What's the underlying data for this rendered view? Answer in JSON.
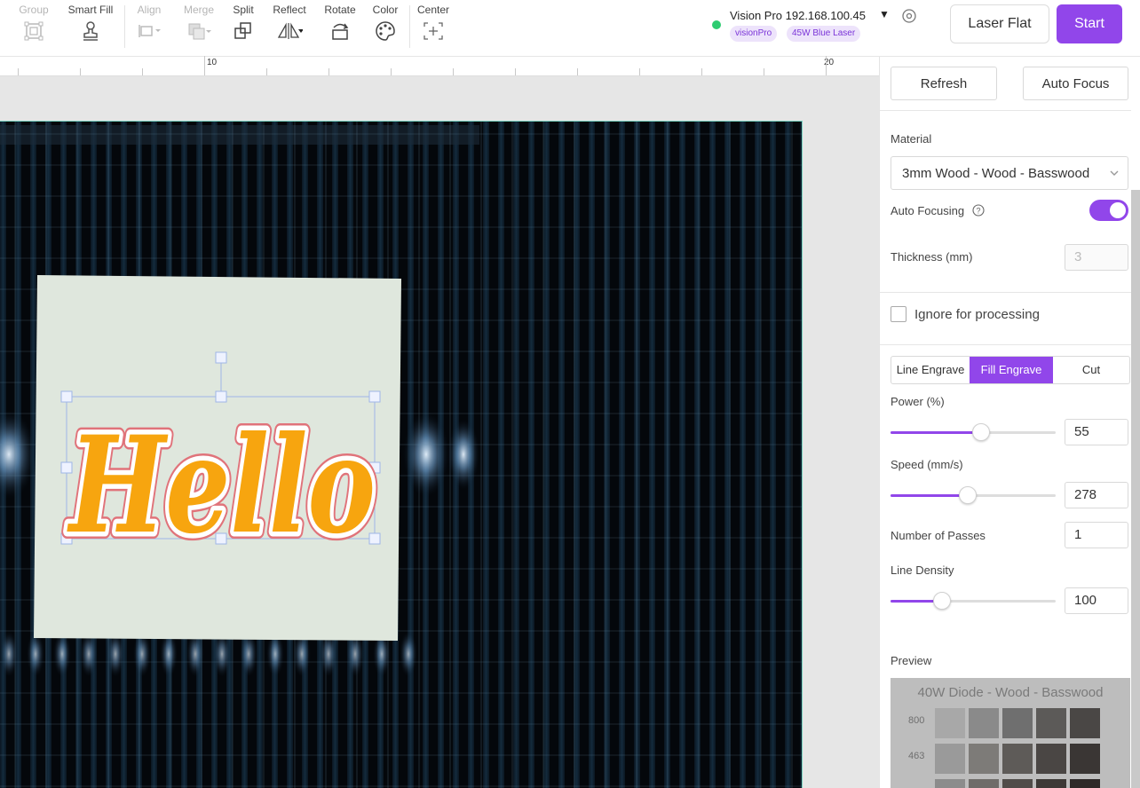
{
  "toolbar": {
    "tools": [
      {
        "key": "group",
        "label": "Group",
        "enabled": false,
        "icon": "group-icon"
      },
      {
        "key": "smart_fill",
        "label": "Smart Fill",
        "enabled": true,
        "icon": "stamp-icon"
      },
      {
        "key": "align",
        "label": "Align",
        "enabled": false,
        "icon": "align-icon"
      },
      {
        "key": "merge",
        "label": "Merge",
        "enabled": false,
        "icon": "merge-icon"
      },
      {
        "key": "split",
        "label": "Split",
        "enabled": true,
        "icon": "split-icon"
      },
      {
        "key": "reflect",
        "label": "Reflect",
        "enabled": true,
        "icon": "reflect-icon"
      },
      {
        "key": "rotate",
        "label": "Rotate",
        "enabled": true,
        "icon": "rotate-icon"
      },
      {
        "key": "color",
        "label": "Color",
        "enabled": true,
        "icon": "palette-icon"
      },
      {
        "key": "center",
        "label": "Center",
        "enabled": true,
        "icon": "center-icon"
      }
    ]
  },
  "device": {
    "name": "Vision Pro 192.168.100.45",
    "status": "connected",
    "status_color": "#2ecc71",
    "badges": [
      "visionPro",
      "45W Blue Laser"
    ]
  },
  "actions": {
    "laser_flat": "Laser Flat",
    "start": "Start",
    "accent_color": "#9146ea"
  },
  "ruler": {
    "labels": [
      "10",
      "20"
    ]
  },
  "canvas": {
    "text": "Hello",
    "text_color": "#f7a50f"
  },
  "panel": {
    "refresh": "Refresh",
    "auto_focus": "Auto Focus",
    "material_label": "Material",
    "material_value": "3mm Wood - Wood - Basswood",
    "auto_focusing_label": "Auto Focusing",
    "auto_focusing_on": true,
    "thickness_label": "Thickness (mm)",
    "thickness_value": "3",
    "ignore_label": "Ignore for processing",
    "ignore_checked": false,
    "modes": [
      "Line Engrave",
      "Fill Engrave",
      "Cut"
    ],
    "active_mode": "Fill Engrave",
    "power_label": "Power (%)",
    "power_value": "55",
    "power_level": 0.55,
    "speed_label": "Speed (mm/s)",
    "speed_value": "278",
    "speed_level": 0.47,
    "passes_label": "Number of Passes",
    "passes_value": "1",
    "density_label": "Line Density",
    "density_value": "100",
    "density_level": 0.31,
    "preview_label": "Preview",
    "preview_title": "40W Diode - Wood - Basswood",
    "preview_rows": [
      "800",
      "463"
    ]
  }
}
